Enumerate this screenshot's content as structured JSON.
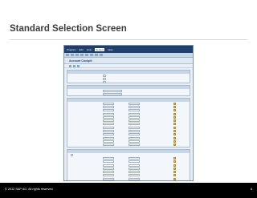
{
  "slide": {
    "title": "Standard Selection Screen",
    "copyright": "© 2012 SAP AG. All rights reserved.",
    "page_number": "6"
  },
  "sap_gui": {
    "menu": [
      {
        "label": "Program",
        "active": false
      },
      {
        "label": "Edit",
        "active": false
      },
      {
        "label": "Goto",
        "active": false
      },
      {
        "label": "System",
        "active": true
      },
      {
        "label": "Help",
        "active": false
      }
    ],
    "screen_title": "Account Cockpit"
  },
  "colors": {
    "menubar": "#1f3f6e",
    "panel_bg": "#e9eff6",
    "group_head": "#c7d6e7",
    "footer": "#000000"
  }
}
